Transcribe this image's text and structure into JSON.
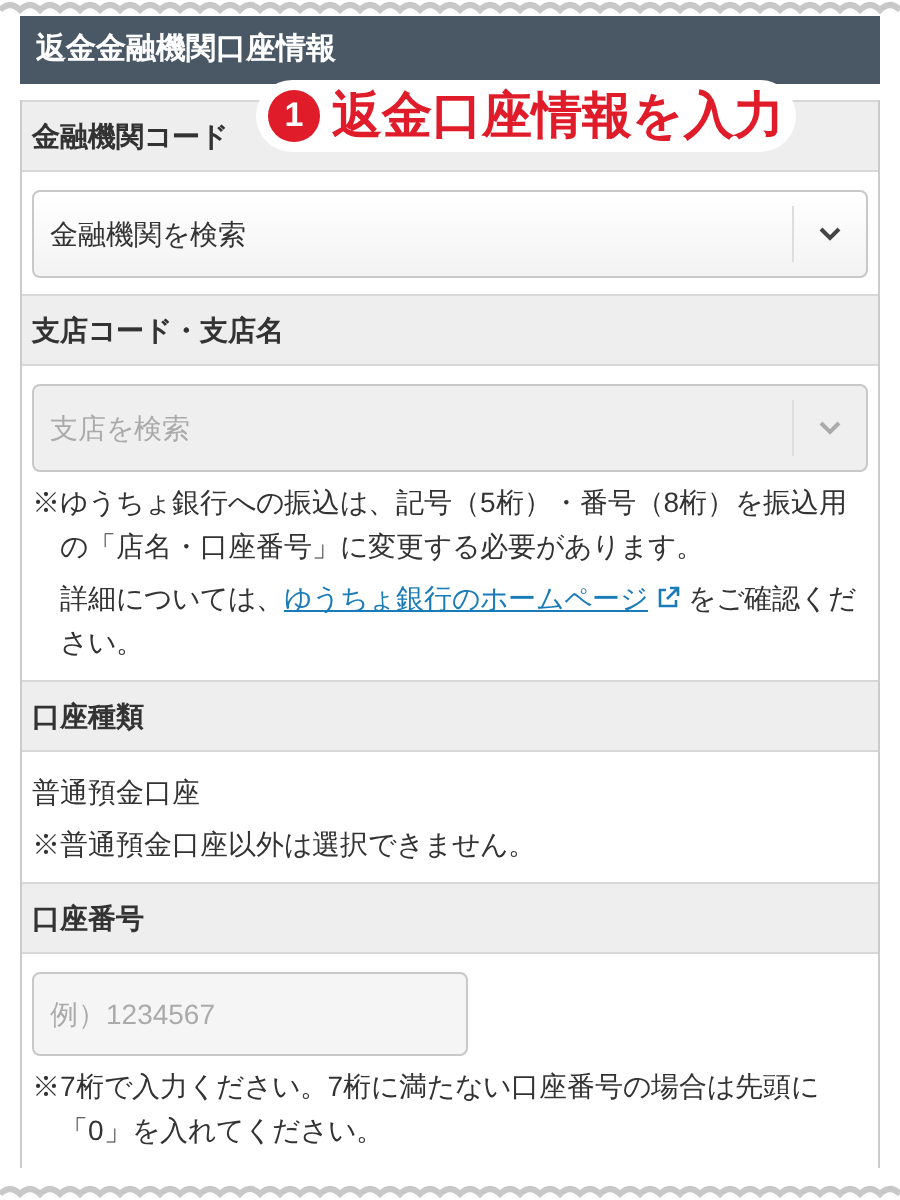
{
  "section_title": "返金金融機関口座情報",
  "callout": {
    "number": "1",
    "text": "返金口座情報を入力"
  },
  "fields": [
    {
      "kind": "select",
      "label": "金融機関コード",
      "placeholder": "金融機関を検索",
      "disabled": false
    },
    {
      "kind": "select",
      "label": "支店コード・支店名",
      "placeholder": "支店を検索",
      "disabled": true,
      "notes": [
        {
          "text": "※ゆうちょ銀行への振込は、記号（5桁）・番号（8桁）を振込用の「店名・口座番号」に変更する必要があります。"
        },
        {
          "text": "詳細については、",
          "link": "ゆうちょ銀行のホームページ",
          "after": "をご確認ください。"
        }
      ]
    },
    {
      "kind": "static",
      "label": "口座種類",
      "value": "普通預金口座",
      "notes": [
        {
          "text": "※普通預金口座以外は選択できません。"
        }
      ]
    },
    {
      "kind": "text",
      "label": "口座番号",
      "placeholder": "例）1234567",
      "disabled": false,
      "notes": [
        {
          "text": "※7桁で入力ください。7桁に満たない口座番号の場合は先頭に「0」を入れてください。"
        }
      ]
    }
  ]
}
